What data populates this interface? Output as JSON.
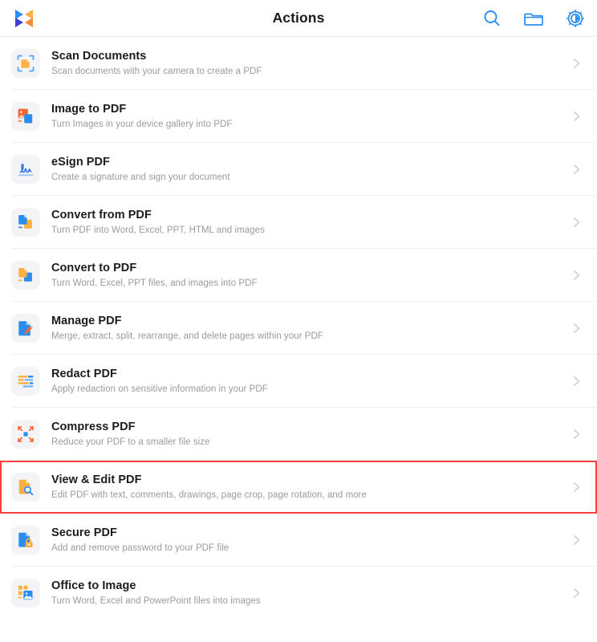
{
  "header": {
    "title": "Actions",
    "logo_name": "app-logo",
    "actions": [
      {
        "name": "search-icon",
        "label": "Search"
      },
      {
        "name": "folder-icon",
        "label": "Files"
      },
      {
        "name": "settings-gear-icon",
        "label": "Settings"
      }
    ]
  },
  "colors": {
    "accent_blue": "#2b8cf0",
    "accent_orange": "#fdb042",
    "accent_orange_red": "#fa6432",
    "selection_red": "#f8403c",
    "title_text": "#1b1c1e",
    "subtitle_text": "#9a9aa2",
    "icon_tile_bg": "#f4f4f6",
    "divider": "#f0f0f2"
  },
  "list": {
    "items": [
      {
        "title": "Scan Documents",
        "subtitle": "Scan documents with your camera to create a PDF",
        "icon": "scan-documents-icon",
        "selected": false
      },
      {
        "title": "Image to PDF",
        "subtitle": "Turn Images in your device gallery into PDF",
        "icon": "image-to-pdf-icon",
        "selected": false
      },
      {
        "title": "eSign PDF",
        "subtitle": "Create a signature and sign your document",
        "icon": "esign-pdf-icon",
        "selected": false
      },
      {
        "title": "Convert from PDF",
        "subtitle": "Turn PDF into Word, Excel, PPT, HTML and images",
        "icon": "convert-from-pdf-icon",
        "selected": false
      },
      {
        "title": "Convert to PDF",
        "subtitle": "Turn Word, Excel, PPT files, and images into PDF",
        "icon": "convert-to-pdf-icon",
        "selected": false
      },
      {
        "title": "Manage PDF",
        "subtitle": "Merge, extract, split, rearrange, and delete pages within your PDF",
        "icon": "manage-pdf-icon",
        "selected": false
      },
      {
        "title": "Redact PDF",
        "subtitle": "Apply redaction on sensitive information in your PDF",
        "icon": "redact-pdf-icon",
        "selected": false
      },
      {
        "title": "Compress PDF",
        "subtitle": "Reduce your PDF to a smaller file size",
        "icon": "compress-pdf-icon",
        "selected": false
      },
      {
        "title": "View & Edit PDF",
        "subtitle": "Edit PDF with text, comments, drawings, page crop, page rotation, and more",
        "icon": "view-edit-pdf-icon",
        "selected": true
      },
      {
        "title": "Secure PDF",
        "subtitle": "Add and remove password to your PDF file",
        "icon": "secure-pdf-icon",
        "selected": false
      },
      {
        "title": "Office to Image",
        "subtitle": "Turn Word, Excel and PowerPoint files into images",
        "icon": "office-to-image-icon",
        "selected": false
      }
    ],
    "chevron_icon": "chevron-right-icon"
  }
}
